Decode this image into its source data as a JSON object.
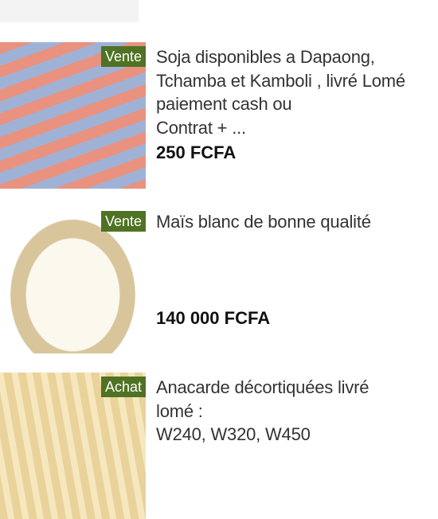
{
  "listings": [
    {
      "badge": "Vente",
      "title_lines": [
        "Soja disponibles a Dapaong,",
        "Tchamba et Kamboli , livré Lomé",
        "paiement cash ou",
        "Contrat + ..."
      ],
      "price": "250 FCFA"
    },
    {
      "badge": "Vente",
      "title_lines": [
        "Maïs blanc de bonne qualité"
      ],
      "price": "140 000 FCFA"
    },
    {
      "badge": "Achat",
      "title_lines": [
        "Anacarde décortiquées livré",
        "lomé :",
        "W240, W320, W450"
      ]
    }
  ]
}
